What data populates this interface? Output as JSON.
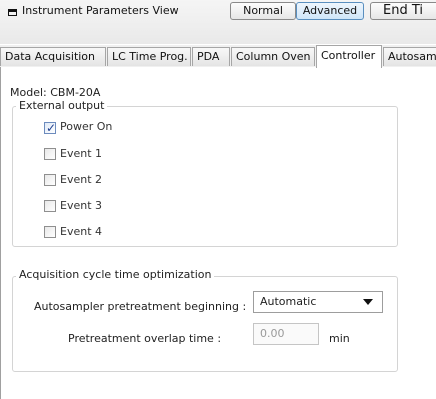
{
  "window": {
    "title": "Instrument Parameters View",
    "modes": {
      "normal": "Normal",
      "advanced": "Advanced",
      "end_time": "End Ti"
    }
  },
  "tabs": [
    {
      "label": "Data Acquisition",
      "active": false
    },
    {
      "label": "LC Time Prog.",
      "active": false
    },
    {
      "label": "PDA",
      "active": false
    },
    {
      "label": "Column Oven",
      "active": false
    },
    {
      "label": "Controller",
      "active": true
    },
    {
      "label": "Autosamp",
      "active": false
    }
  ],
  "model": "Model: CBM-20A",
  "external_output": {
    "legend": "External output",
    "items": [
      {
        "label": "Power On",
        "checked": true
      },
      {
        "label": "Event 1",
        "checked": false
      },
      {
        "label": "Event 2",
        "checked": false
      },
      {
        "label": "Event 3",
        "checked": false
      },
      {
        "label": "Event 4",
        "checked": false
      }
    ]
  },
  "acquisition": {
    "legend": "Acquisition cycle time optimization",
    "autosampler_label": "Autosampler pretreatment beginning :",
    "autosampler_value": "Automatic",
    "overlap_label": "Pretreatment overlap time :",
    "overlap_value": "0.00",
    "overlap_unit": "min"
  }
}
